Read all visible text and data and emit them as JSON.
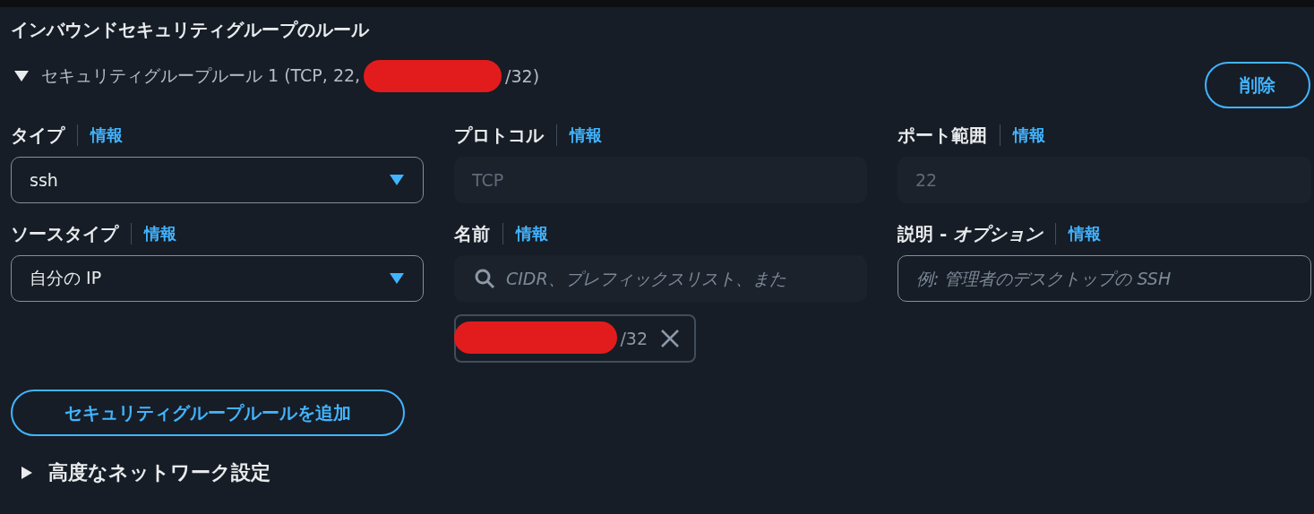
{
  "section_title": "インバウンドセキュリティグループのルール",
  "rule": {
    "expanded": true,
    "title": "セキュリティグループルール 1 (TCP, 22,",
    "title_end": "/32)",
    "redacted": true,
    "delete_button": "削除"
  },
  "fields": [
    {
      "kind": "select",
      "label": "タイプ",
      "info": "情報",
      "value": "ssh",
      "disabled": false
    },
    {
      "kind": "readonly",
      "label": "プロトコル",
      "info": "情報",
      "value": "TCP",
      "disabled": true
    },
    {
      "kind": "readonly",
      "label": "ポート範囲",
      "info": "情報",
      "value": "22",
      "disabled": true
    },
    {
      "kind": "select",
      "label": "ソースタイプ",
      "info": "情報",
      "value": "自分の IP",
      "disabled": false
    },
    {
      "kind": "search",
      "label": "名前",
      "info": "情報",
      "placeholder": "CIDR、プレフィックスリスト、また",
      "disabled": false,
      "tokens": [
        {
          "text": "/32",
          "redacted": true
        }
      ]
    },
    {
      "kind": "text",
      "label": "説明 - *オプション*",
      "info": "情報",
      "placeholder": "例: 管理者のデスクトップの SSH",
      "disabled": false
    }
  ],
  "add_button": "セキュリティグループルールを追加",
  "advanced": {
    "label": "高度なネットワーク設定",
    "expanded": false
  }
}
